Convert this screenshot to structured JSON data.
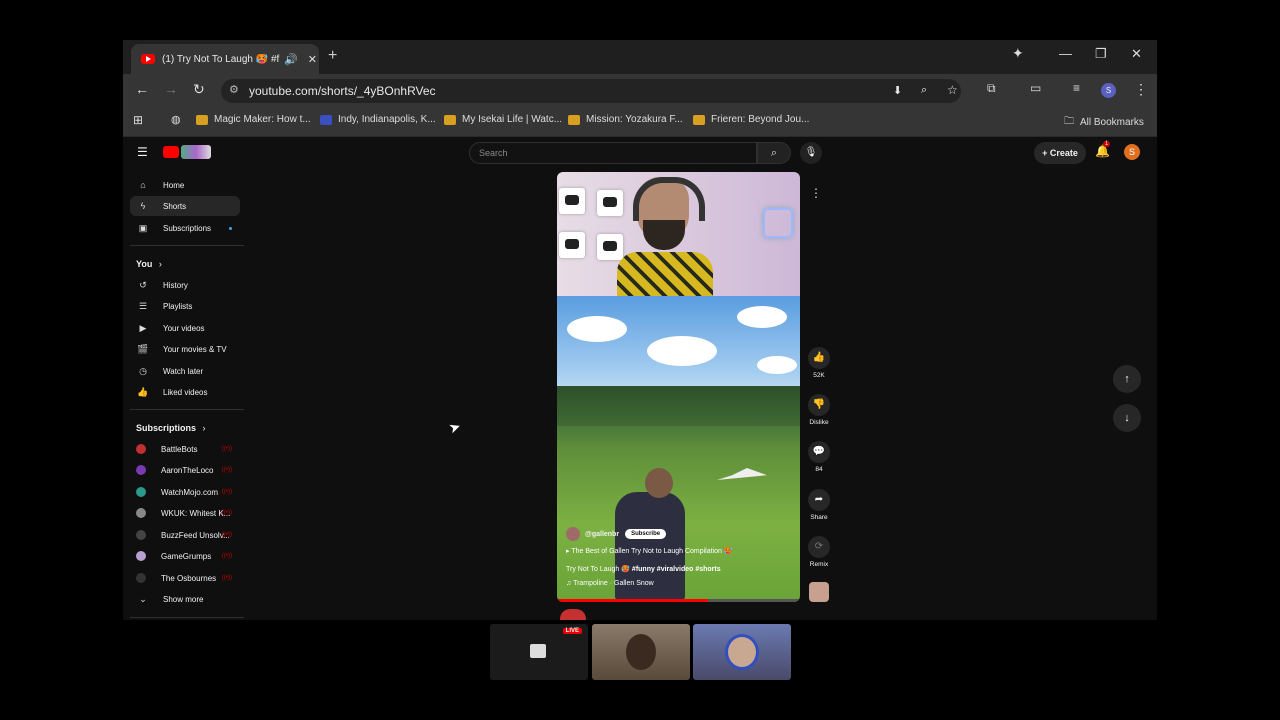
{
  "browser": {
    "tab_title": "(1) Try Not To Laugh 🥵 #fu",
    "url": "youtube.com/shorts/_4yBOnhRVec",
    "bookmarks": [
      {
        "label": "Magic Maker: How t...",
        "color": "#d8a020"
      },
      {
        "label": "Indy, Indianapolis, K...",
        "color": "#3a4fc0"
      },
      {
        "label": "My Isekai Life | Watc...",
        "color": "#d8a020"
      },
      {
        "label": "Mission: Yozakura F...",
        "color": "#d8a020"
      },
      {
        "label": "Frieren: Beyond Jou...",
        "color": "#d8a020"
      }
    ],
    "all_bookmarks_label": "All Bookmarks",
    "profile_initial": "S"
  },
  "youtube": {
    "search_placeholder": "Search",
    "create_label": "Create",
    "notification_count": "1",
    "avatar_initial": "S",
    "sidebar": {
      "main": [
        {
          "label": "Home",
          "icon": "home-icon"
        },
        {
          "label": "Shorts",
          "icon": "shorts-icon",
          "active": true
        },
        {
          "label": "Subscriptions",
          "icon": "subscriptions-icon"
        }
      ],
      "you_title": "You",
      "you_items": [
        {
          "label": "History"
        },
        {
          "label": "Playlists"
        },
        {
          "label": "Your videos"
        },
        {
          "label": "Your movies & TV"
        },
        {
          "label": "Watch later"
        },
        {
          "label": "Liked videos"
        }
      ],
      "subs_title": "Subscriptions",
      "subs": [
        {
          "label": "BattleBots",
          "color": "#c03030"
        },
        {
          "label": "AaronTheLoco",
          "color": "#7a3ab0"
        },
        {
          "label": "WatchMojo.com",
          "color": "#2a9a8a"
        },
        {
          "label": "WKUK: Whitest K...",
          "color": "#888"
        },
        {
          "label": "BuzzFeed Unsolv...",
          "color": "#444"
        },
        {
          "label": "GameGrumps",
          "color": "#b8a0d0"
        },
        {
          "label": "The Osbournes",
          "color": "#333"
        }
      ],
      "show_more": "Show more"
    },
    "short": {
      "channel": "@gallenbr",
      "subscribe": "Subscribe",
      "playlist_line": "▸ The Best of Gallen Try Not to Laugh Compilation 🥵",
      "title": "Try Not To Laugh 🥵 ",
      "hashtags": "#funny #viralvideo #shorts",
      "audio": "♫ Trampoline · Gallen Snow",
      "progress": 0.62
    },
    "actions": {
      "likes": "52K",
      "dislike": "Dislike",
      "comments": "84",
      "share": "Share",
      "remix": "Remix"
    }
  },
  "taskbar": {
    "live_label": "LIVE"
  }
}
